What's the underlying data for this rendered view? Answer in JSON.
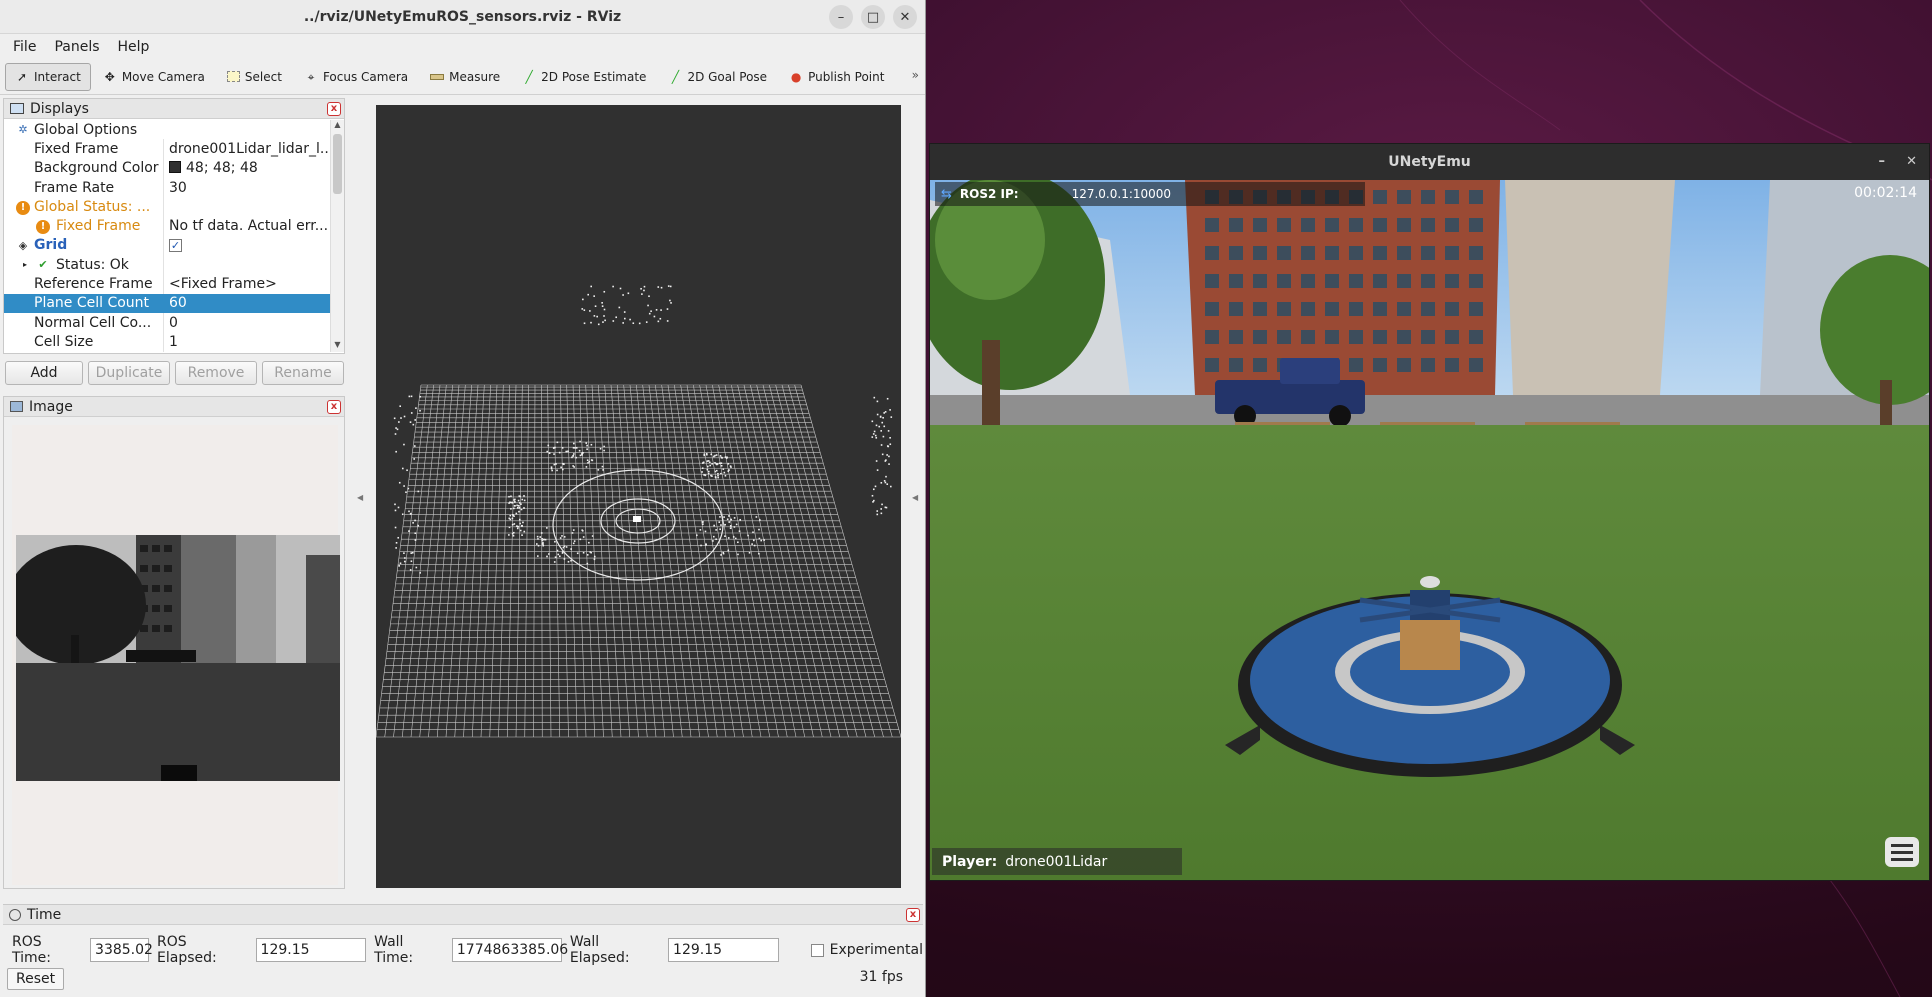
{
  "rviz": {
    "title": "../rviz/UNetyEmuROS_sensors.rviz - RViz",
    "menu": [
      "File",
      "Panels",
      "Help"
    ],
    "tools": [
      {
        "label": "Interact",
        "icon": "cursor-icon"
      },
      {
        "label": "Move Camera",
        "icon": "move-icon"
      },
      {
        "label": "Select",
        "icon": "select-box-icon"
      },
      {
        "label": "Focus Camera",
        "icon": "focus-icon"
      },
      {
        "label": "Measure",
        "icon": "ruler-icon"
      },
      {
        "label": "2D Pose Estimate",
        "icon": "green-arrow-icon"
      },
      {
        "label": "2D Goal Pose",
        "icon": "green-arrow-icon"
      },
      {
        "label": "Publish Point",
        "icon": "pin-icon"
      }
    ],
    "displays": {
      "title": "Displays",
      "rows": [
        {
          "key": "Global Options",
          "value": ""
        },
        {
          "key": "Fixed Frame",
          "value": "drone001Lidar_lidar_l..."
        },
        {
          "key": "Background Color",
          "value": "48; 48; 48"
        },
        {
          "key": "Frame Rate",
          "value": "30"
        },
        {
          "key": "Global Status: ...",
          "value": ""
        },
        {
          "key": "Fixed Frame",
          "value": "No tf data.  Actual err..."
        },
        {
          "key": "Grid",
          "value": "✓"
        },
        {
          "key": "Status: Ok",
          "value": ""
        },
        {
          "key": "Reference Frame",
          "value": "<Fixed Frame>"
        },
        {
          "key": "Plane Cell Count",
          "value": "60"
        },
        {
          "key": "Normal Cell Co...",
          "value": "0"
        },
        {
          "key": "Cell Size",
          "value": "1"
        }
      ],
      "buttons": [
        "Add",
        "Duplicate",
        "Remove",
        "Rename"
      ]
    },
    "image_panel": {
      "title": "Image"
    },
    "time": {
      "title": "Time",
      "ros_time_label": "ROS Time:",
      "ros_time": "3385.02",
      "ros_elapsed_label": "ROS Elapsed:",
      "ros_elapsed": "129.15",
      "wall_time_label": "Wall Time:",
      "wall_time": "1774863385.06",
      "wall_elapsed_label": "Wall Elapsed:",
      "wall_elapsed": "129.15",
      "experimental": "Experimental",
      "reset": "Reset",
      "fps": "31 fps"
    }
  },
  "unity": {
    "title": "UNetyEmu",
    "ip_label": "ROS2 IP:",
    "ip_value": "127.0.0.1:10000",
    "timer": "00:02:14",
    "player_label": "Player:",
    "player_value": "drone001Lidar"
  },
  "colors": {
    "selection": "#308cc6",
    "rviz_background": "#303030",
    "warning": "#e88b12",
    "pad_blue": "#2d5fa0"
  }
}
